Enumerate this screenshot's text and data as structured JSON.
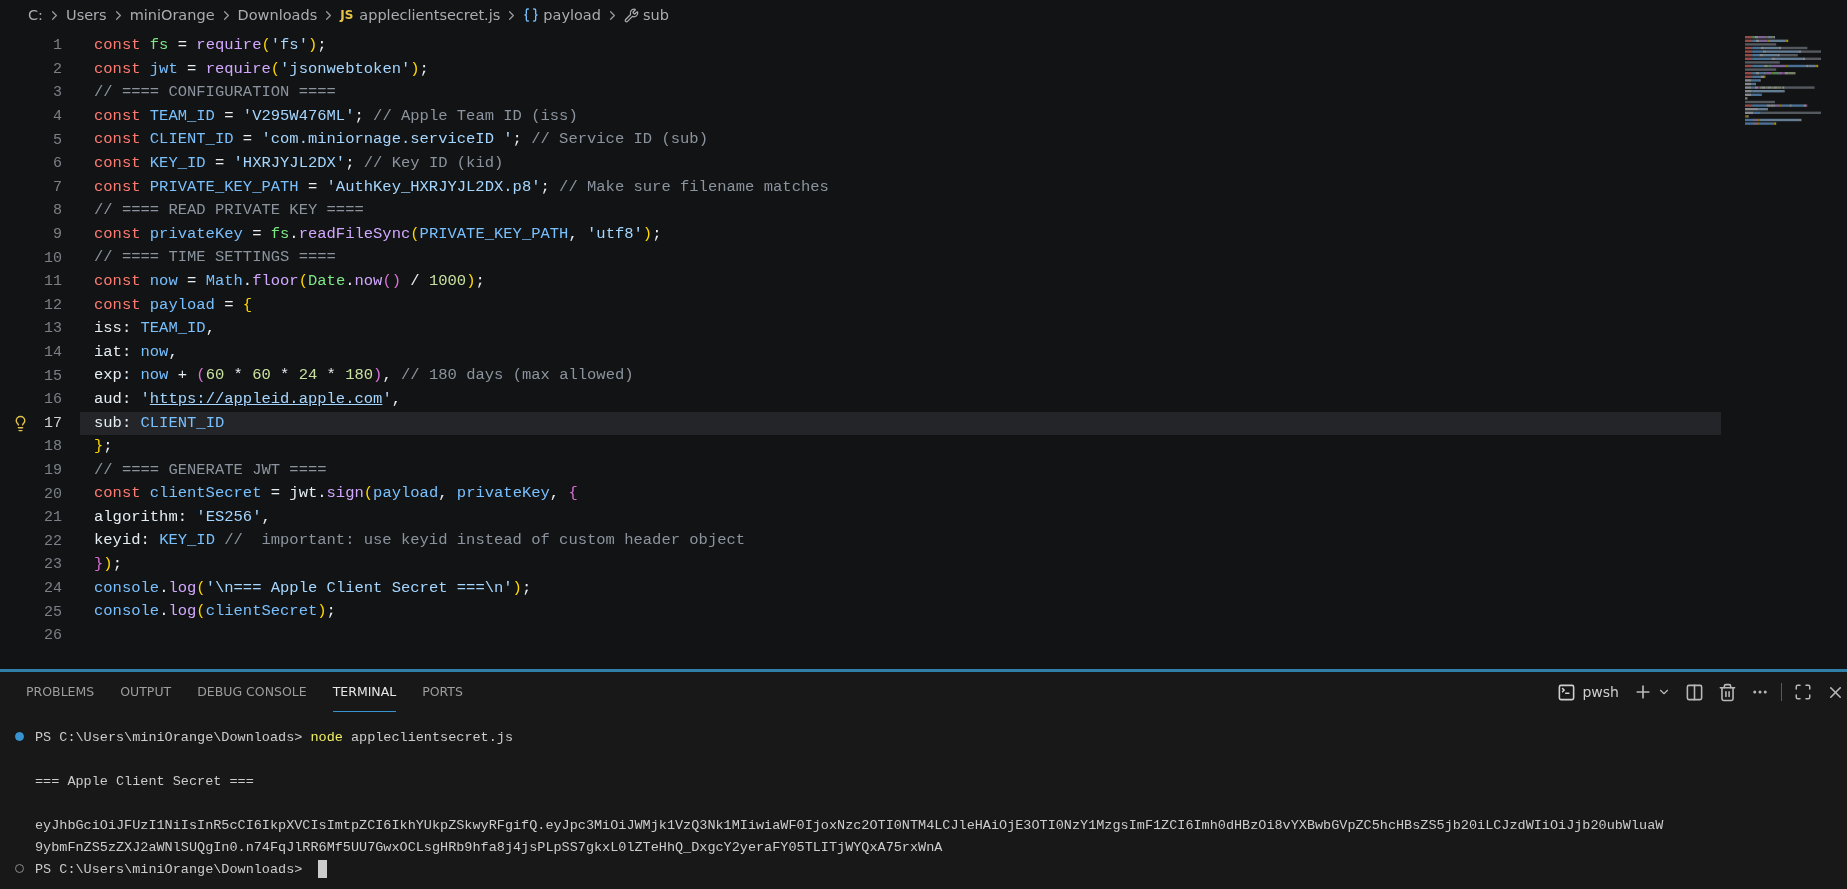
{
  "breadcrumb": [
    {
      "label": "C:",
      "kind": "folder"
    },
    {
      "label": "Users",
      "kind": "folder"
    },
    {
      "label": "miniOrange",
      "kind": "folder"
    },
    {
      "label": "Downloads",
      "kind": "folder"
    },
    {
      "label": "appleclientsecret.js",
      "kind": "file",
      "badge": "JS"
    },
    {
      "label": "payload",
      "kind": "object"
    },
    {
      "label": "sub",
      "kind": "property"
    }
  ],
  "editor": {
    "lines": [
      {
        "number": "1",
        "tokens": [
          {
            "text": "const ",
            "kind": "keyword"
          },
          {
            "text": "fs",
            "kind": "module"
          },
          {
            "text": " = ",
            "kind": "plain"
          },
          {
            "text": "require",
            "kind": "function"
          },
          {
            "text": "(",
            "kind": "bracket1"
          },
          {
            "text": "'fs'",
            "kind": "string"
          },
          {
            "text": ")",
            "kind": "bracket1"
          },
          {
            "text": ";",
            "kind": "plain"
          }
        ]
      },
      {
        "number": "2",
        "tokens": [
          {
            "text": "const ",
            "kind": "keyword"
          },
          {
            "text": "jwt",
            "kind": "variable"
          },
          {
            "text": " = ",
            "kind": "plain"
          },
          {
            "text": "require",
            "kind": "function"
          },
          {
            "text": "(",
            "kind": "bracket1"
          },
          {
            "text": "'jsonwebtoken'",
            "kind": "string"
          },
          {
            "text": ")",
            "kind": "bracket1"
          },
          {
            "text": ";",
            "kind": "plain"
          }
        ]
      },
      {
        "number": "3",
        "tokens": [
          {
            "text": "// ==== CONFIGURATION ====",
            "kind": "comment"
          }
        ]
      },
      {
        "number": "4",
        "tokens": [
          {
            "text": "const ",
            "kind": "keyword"
          },
          {
            "text": "TEAM_ID",
            "kind": "variable"
          },
          {
            "text": " = ",
            "kind": "plain"
          },
          {
            "text": "'V295W476ML'",
            "kind": "string"
          },
          {
            "text": "; ",
            "kind": "plain"
          },
          {
            "text": "// Apple Team ID (iss)",
            "kind": "comment"
          }
        ]
      },
      {
        "number": "5",
        "tokens": [
          {
            "text": "const ",
            "kind": "keyword"
          },
          {
            "text": "CLIENT_ID",
            "kind": "variable"
          },
          {
            "text": " = ",
            "kind": "plain"
          },
          {
            "text": "'com.miniornage.serviceID '",
            "kind": "string"
          },
          {
            "text": "; ",
            "kind": "plain"
          },
          {
            "text": "// Service ID (sub)",
            "kind": "comment"
          }
        ]
      },
      {
        "number": "6",
        "tokens": [
          {
            "text": "const ",
            "kind": "keyword"
          },
          {
            "text": "KEY_ID",
            "kind": "variable"
          },
          {
            "text": " = ",
            "kind": "plain"
          },
          {
            "text": "'HXRJYJL2DX'",
            "kind": "string"
          },
          {
            "text": "; ",
            "kind": "plain"
          },
          {
            "text": "// Key ID (kid)",
            "kind": "comment"
          }
        ]
      },
      {
        "number": "7",
        "tokens": [
          {
            "text": "const ",
            "kind": "keyword"
          },
          {
            "text": "PRIVATE_KEY_PATH",
            "kind": "variable"
          },
          {
            "text": " = ",
            "kind": "plain"
          },
          {
            "text": "'AuthKey_HXRJYJL2DX.p8'",
            "kind": "string"
          },
          {
            "text": "; ",
            "kind": "plain"
          },
          {
            "text": "// Make sure filename matches",
            "kind": "comment"
          }
        ]
      },
      {
        "number": "8",
        "tokens": [
          {
            "text": "// ==== READ PRIVATE KEY ====",
            "kind": "comment"
          }
        ]
      },
      {
        "number": "9",
        "tokens": [
          {
            "text": "const ",
            "kind": "keyword"
          },
          {
            "text": "privateKey",
            "kind": "variable"
          },
          {
            "text": " = ",
            "kind": "plain"
          },
          {
            "text": "fs",
            "kind": "module"
          },
          {
            "text": ".",
            "kind": "plain"
          },
          {
            "text": "readFileSync",
            "kind": "function"
          },
          {
            "text": "(",
            "kind": "bracket1"
          },
          {
            "text": "PRIVATE_KEY_PATH",
            "kind": "variable"
          },
          {
            "text": ", ",
            "kind": "plain"
          },
          {
            "text": "'utf8'",
            "kind": "string"
          },
          {
            "text": ")",
            "kind": "bracket1"
          },
          {
            "text": ";",
            "kind": "plain"
          }
        ]
      },
      {
        "number": "10",
        "tokens": [
          {
            "text": "// ==== TIME SETTINGS ====",
            "kind": "comment"
          }
        ]
      },
      {
        "number": "11",
        "tokens": [
          {
            "text": "const ",
            "kind": "keyword"
          },
          {
            "text": "now",
            "kind": "variable"
          },
          {
            "text": " = ",
            "kind": "plain"
          },
          {
            "text": "Math",
            "kind": "variable"
          },
          {
            "text": ".",
            "kind": "plain"
          },
          {
            "text": "floor",
            "kind": "function"
          },
          {
            "text": "(",
            "kind": "bracket1"
          },
          {
            "text": "Date",
            "kind": "module"
          },
          {
            "text": ".",
            "kind": "plain"
          },
          {
            "text": "now",
            "kind": "function"
          },
          {
            "text": "()",
            "kind": "bracket2"
          },
          {
            "text": " / ",
            "kind": "plain"
          },
          {
            "text": "1000",
            "kind": "number"
          },
          {
            "text": ")",
            "kind": "bracket1"
          },
          {
            "text": ";",
            "kind": "plain"
          }
        ]
      },
      {
        "number": "12",
        "tokens": [
          {
            "text": "const ",
            "kind": "keyword"
          },
          {
            "text": "payload",
            "kind": "variable"
          },
          {
            "text": " = ",
            "kind": "plain"
          },
          {
            "text": "{",
            "kind": "bracket1"
          }
        ]
      },
      {
        "number": "13",
        "tokens": [
          {
            "text": "iss: ",
            "kind": "plain"
          },
          {
            "text": "TEAM_ID",
            "kind": "variable"
          },
          {
            "text": ",",
            "kind": "plain"
          }
        ]
      },
      {
        "number": "14",
        "tokens": [
          {
            "text": "iat: ",
            "kind": "plain"
          },
          {
            "text": "now",
            "kind": "variable"
          },
          {
            "text": ",",
            "kind": "plain"
          }
        ]
      },
      {
        "number": "15",
        "tokens": [
          {
            "text": "exp: ",
            "kind": "plain"
          },
          {
            "text": "now",
            "kind": "variable"
          },
          {
            "text": " + ",
            "kind": "plain"
          },
          {
            "text": "(",
            "kind": "bracket2"
          },
          {
            "text": "60",
            "kind": "number"
          },
          {
            "text": " * ",
            "kind": "plain"
          },
          {
            "text": "60",
            "kind": "number"
          },
          {
            "text": " * ",
            "kind": "plain"
          },
          {
            "text": "24",
            "kind": "number"
          },
          {
            "text": " * ",
            "kind": "plain"
          },
          {
            "text": "180",
            "kind": "number"
          },
          {
            "text": ")",
            "kind": "bracket2"
          },
          {
            "text": ", ",
            "kind": "plain"
          },
          {
            "text": "// 180 days (max allowed)",
            "kind": "comment"
          }
        ]
      },
      {
        "number": "16",
        "tokens": [
          {
            "text": "aud: ",
            "kind": "plain"
          },
          {
            "text": "'",
            "kind": "string"
          },
          {
            "text": "https://appleid.apple.com",
            "kind": "link"
          },
          {
            "text": "'",
            "kind": "string"
          },
          {
            "text": ",",
            "kind": "plain"
          }
        ]
      },
      {
        "number": "17",
        "current": true,
        "lightbulb": true,
        "tokens": [
          {
            "text": "sub: ",
            "kind": "plain"
          },
          {
            "text": "CLIENT_ID",
            "kind": "variable"
          }
        ]
      },
      {
        "number": "18",
        "tokens": [
          {
            "text": "}",
            "kind": "bracket1"
          },
          {
            "text": ";",
            "kind": "plain"
          }
        ]
      },
      {
        "number": "19",
        "tokens": [
          {
            "text": "// ==== GENERATE JWT ====",
            "kind": "comment"
          }
        ]
      },
      {
        "number": "20",
        "tokens": [
          {
            "text": "const ",
            "kind": "keyword"
          },
          {
            "text": "clientSecret",
            "kind": "variable"
          },
          {
            "text": " = ",
            "kind": "plain"
          },
          {
            "text": "jwt",
            "kind": "plain"
          },
          {
            "text": ".",
            "kind": "plain"
          },
          {
            "text": "sign",
            "kind": "function"
          },
          {
            "text": "(",
            "kind": "bracket1"
          },
          {
            "text": "payload",
            "kind": "variable"
          },
          {
            "text": ", ",
            "kind": "plain"
          },
          {
            "text": "privateKey",
            "kind": "variable"
          },
          {
            "text": ", ",
            "kind": "plain"
          },
          {
            "text": "{",
            "kind": "bracket2"
          }
        ]
      },
      {
        "number": "21",
        "tokens": [
          {
            "text": "algorithm: ",
            "kind": "plain"
          },
          {
            "text": "'ES256'",
            "kind": "string"
          },
          {
            "text": ",",
            "kind": "plain"
          }
        ]
      },
      {
        "number": "22",
        "tokens": [
          {
            "text": "keyid: ",
            "kind": "plain"
          },
          {
            "text": "KEY_ID",
            "kind": "variable"
          },
          {
            "text": " //  important: use keyid instead of custom header object",
            "kind": "comment"
          }
        ]
      },
      {
        "number": "23",
        "tokens": [
          {
            "text": "}",
            "kind": "bracket2"
          },
          {
            "text": ")",
            "kind": "bracket1"
          },
          {
            "text": ";",
            "kind": "plain"
          }
        ]
      },
      {
        "number": "24",
        "tokens": [
          {
            "text": "console",
            "kind": "variable"
          },
          {
            "text": ".",
            "kind": "plain"
          },
          {
            "text": "log",
            "kind": "function"
          },
          {
            "text": "(",
            "kind": "bracket1"
          },
          {
            "text": "'\\n=== Apple Client Secret ===\\n'",
            "kind": "string"
          },
          {
            "text": ")",
            "kind": "bracket1"
          },
          {
            "text": ";",
            "kind": "plain"
          }
        ]
      },
      {
        "number": "25",
        "tokens": [
          {
            "text": "console",
            "kind": "variable"
          },
          {
            "text": ".",
            "kind": "plain"
          },
          {
            "text": "log",
            "kind": "function"
          },
          {
            "text": "(",
            "kind": "bracket1"
          },
          {
            "text": "clientSecret",
            "kind": "variable"
          },
          {
            "text": ")",
            "kind": "bracket1"
          },
          {
            "text": ";",
            "kind": "plain"
          }
        ]
      },
      {
        "number": "26"
      }
    ]
  },
  "panel": {
    "tabs": [
      {
        "label": "PROBLEMS",
        "selected": false
      },
      {
        "label": "OUTPUT",
        "selected": false
      },
      {
        "label": "DEBUG CONSOLE",
        "selected": false
      },
      {
        "label": "TERMINAL",
        "selected": true
      },
      {
        "label": "PORTS",
        "selected": false
      }
    ],
    "shell": "pwsh"
  },
  "terminal": {
    "lines": [
      {
        "kind": "command",
        "succeeded": true,
        "prompt": "PS C:\\Users\\miniOrange\\Downloads>",
        "command": "node",
        "args": "appleclientsecret.js"
      },
      {
        "kind": "blank"
      },
      {
        "kind": "output",
        "text": "=== Apple Client Secret ==="
      },
      {
        "kind": "blank"
      },
      {
        "kind": "output",
        "text": "eyJhbGciOiJFUzI1NiIsInR5cCI6IkpXVCIsImtpZCI6IkhYUkpZSkwyRFgifQ.eyJpc3MiOiJWMjk1VzQ3Nk1MIiwiaWF0IjoxNzc2OTI0NTM4LCJleHAiOjE3OTI0NzY1MzgsImF1ZCI6Imh0dHBzOi8vYXBwbGVpZC5hcHBsZS5jb20iLCJzdWIiOiJjb20ubWluaW"
      },
      {
        "kind": "output",
        "text": "9ybmFnZS5zZXJ2aWNlSUQgIn0.n74FqJlRR6Mf5UU7GwxOCLsgHRb9hfa8j4jsPLpSS7gkxL0lZTeHhQ_DxgcY2yeraFY05TLITjWYQxA75rxWnA"
      },
      {
        "kind": "command",
        "succeeded": false,
        "prompt": "PS C:\\Users\\miniOrange\\Downloads>",
        "cursor": true
      }
    ]
  }
}
